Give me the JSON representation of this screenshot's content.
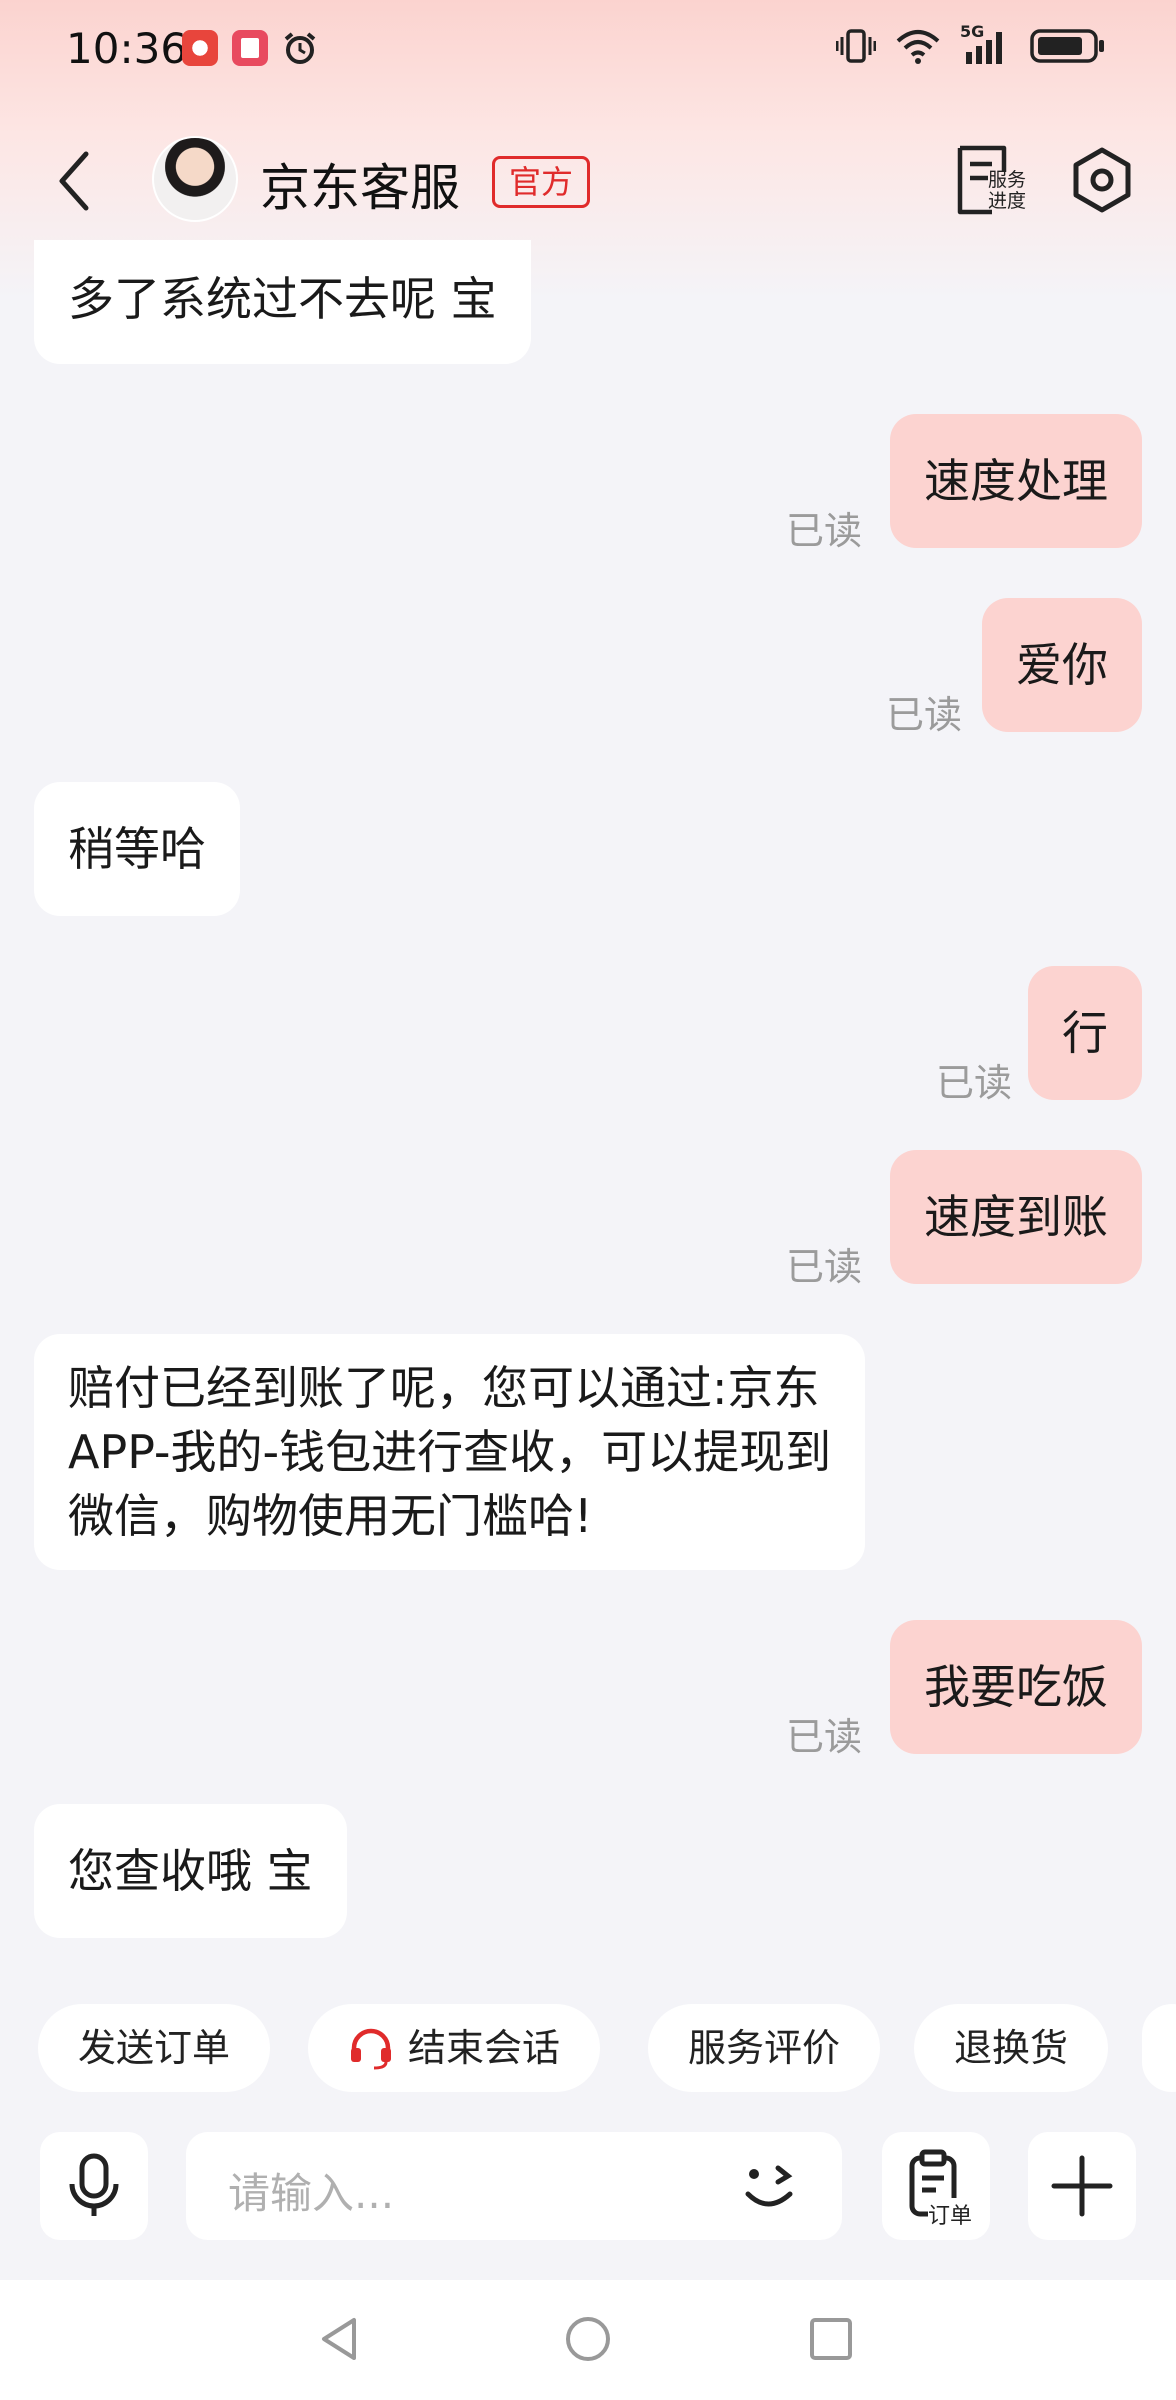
{
  "status_bar": {
    "time": "10:36",
    "network": "5G"
  },
  "header": {
    "title": "京东客服",
    "badge": "官方",
    "service_progress_label": "服务\n进度"
  },
  "messages": [
    {
      "dir": "in",
      "text": "多了系统过不去呢 宝"
    },
    {
      "dir": "out",
      "text": "速度处理",
      "read": "已读"
    },
    {
      "dir": "out",
      "text": "爱你",
      "read": "已读"
    },
    {
      "dir": "in",
      "text": "稍等哈"
    },
    {
      "dir": "out",
      "text": "行",
      "read": "已读"
    },
    {
      "dir": "out",
      "text": "速度到账",
      "read": "已读"
    },
    {
      "dir": "in",
      "lines": [
        "赔付已经到账了呢，您可以通过:京东",
        "APP-我的-钱包进行查收，可以提现到",
        "微信，购物使用无门槛哈!"
      ]
    },
    {
      "dir": "out",
      "text": "我要吃饭",
      "read": "已读"
    },
    {
      "dir": "in",
      "text": "您查收哦 宝"
    }
  ],
  "quick_replies": [
    "发送订单",
    "结束会话",
    "服务评价",
    "退换货"
  ],
  "input": {
    "placeholder": "请输入...",
    "order_label": "订单"
  },
  "colors": {
    "accent": "#e02b2b",
    "out_bubble": "#fcd3d0",
    "in_bubble": "#ffffff",
    "background": "#f4f4f8"
  }
}
